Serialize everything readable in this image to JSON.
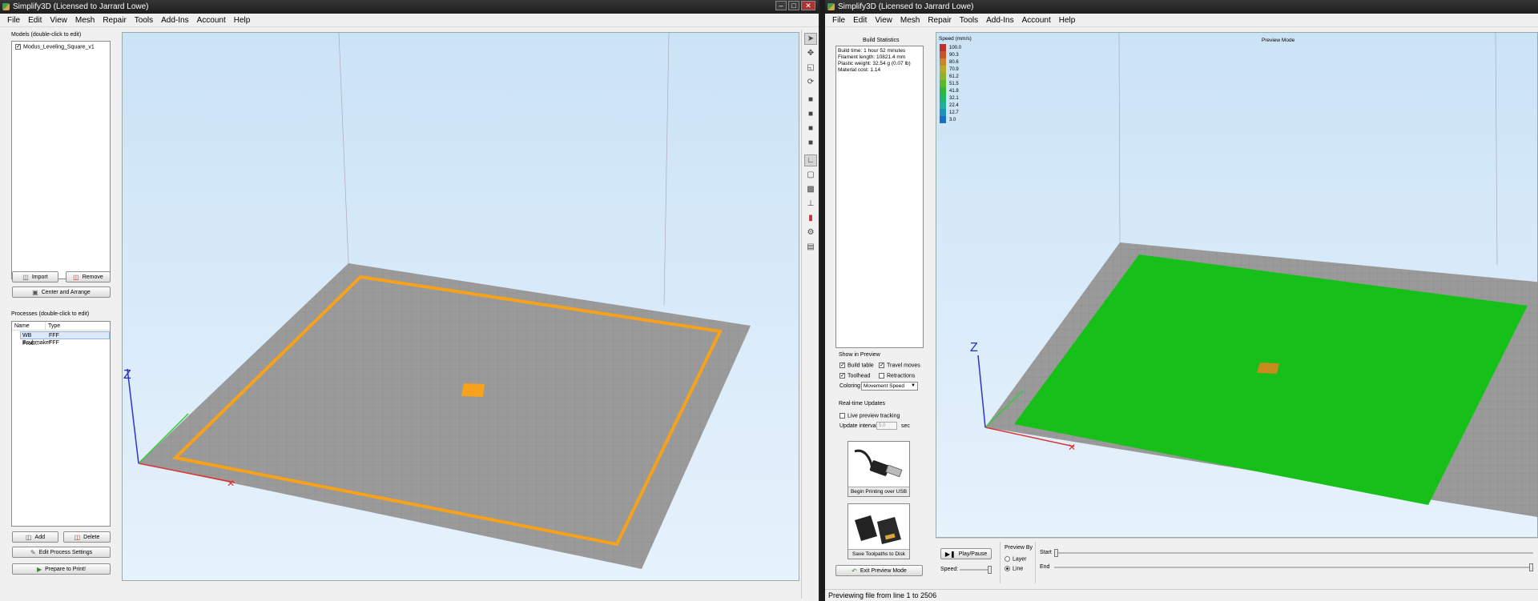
{
  "left": {
    "title": "Simplify3D (Licensed to Jarrard Lowe)",
    "menu": [
      "File",
      "Edit",
      "View",
      "Mesh",
      "Repair",
      "Tools",
      "Add-Ins",
      "Account",
      "Help"
    ],
    "models_label": "Models (double-click to edit)",
    "models": [
      "Modus_Leveling_Square_v1"
    ],
    "import_label": "Import",
    "remove_label": "Remove",
    "center_label": "Center and Arrange",
    "processes_label": "Processes (double-click to edit)",
    "col_name": "Name",
    "col_type": "Type",
    "processes": [
      {
        "name": "WB Proc...",
        "type": "FFF"
      },
      {
        "name": "Ecubmaker",
        "type": "FFF"
      }
    ],
    "add_label": "Add",
    "delete_label": "Delete",
    "edit_process_label": "Edit Process Settings",
    "prepare_label": "Prepare to Print!",
    "axis_z": "Z"
  },
  "right": {
    "title": "Simplify3D (Licensed to Jarrard Lowe)",
    "menu": [
      "File",
      "Edit",
      "View",
      "Mesh",
      "Repair",
      "Tools",
      "Add-Ins",
      "Account",
      "Help"
    ],
    "build_stats_title": "Build Statistics",
    "build_stats": [
      "Build time: 1 hour 52 minutes",
      "Filament length: 10821.4 mm",
      "Plastic weight: 32.54 g (0.07 lb)",
      "Material cost: 1.14"
    ],
    "show_in_preview": "Show in Preview",
    "build_table": "Build table",
    "travel_moves": "Travel moves",
    "toolhead": "Toolhead",
    "retractions": "Retractions",
    "coloring_label": "Coloring",
    "coloring_value": "Movement Speed",
    "realtime_label": "Real-time Updates",
    "live_tracking": "Live preview tracking",
    "update_interval": "Update interval",
    "update_value": "5.0",
    "update_unit": "sec",
    "usb_label": "Begin Printing over USB",
    "sd_label": "Save Toolpaths to Disk",
    "exit_label": "Exit Preview Mode",
    "speed_title": "Speed (mm/s)",
    "preview_mode": "Preview Mode",
    "legend": [
      {
        "v": "100.0",
        "c": "#c0302a"
      },
      {
        "v": "90.3",
        "c": "#c8532a"
      },
      {
        "v": "80.6",
        "c": "#c9852a"
      },
      {
        "v": "70.9",
        "c": "#b9a82a"
      },
      {
        "v": "61.2",
        "c": "#90b22a"
      },
      {
        "v": "51.5",
        "c": "#5cb62a"
      },
      {
        "v": "41.8",
        "c": "#2fb83a"
      },
      {
        "v": "32.1",
        "c": "#22b56a"
      },
      {
        "v": "22.4",
        "c": "#1fb09a"
      },
      {
        "v": "12.7",
        "c": "#1c96b8"
      },
      {
        "v": "3.0",
        "c": "#1a6fc0"
      }
    ],
    "play_label": "Play/Pause",
    "speed_label": "Speed:",
    "preview_by": "Preview By",
    "layer_label": "Layer",
    "line_label": "Line",
    "start_label": "Start",
    "end_label": "End",
    "status": "Previewing file from line 1 to 2506",
    "axis_z": "Z"
  }
}
